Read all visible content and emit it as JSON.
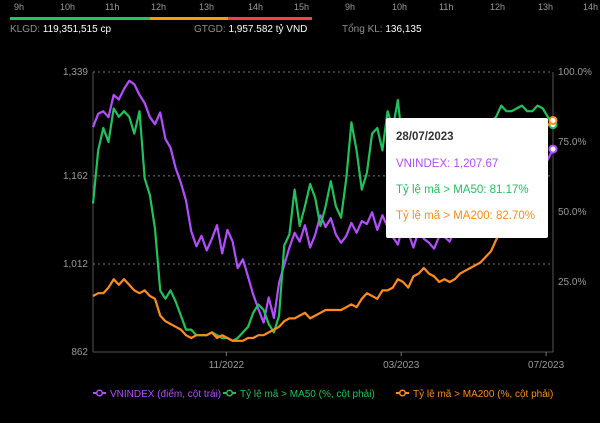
{
  "hours_top": [
    "9h",
    "10h",
    "11h",
    "12h",
    "13h",
    "14h",
    "15h"
  ],
  "hours_right": [
    "9h",
    "10h",
    "11h",
    "12h",
    "13h",
    "14h"
  ],
  "stats": {
    "klgd_label": "KLGD:",
    "klgd_value": "119,351,515 cp",
    "gtgd_label": "GTGD:",
    "gtgd_value": "1,957.582 tỷ VND",
    "tongkl_label": "Tổng KL:",
    "tongkl_value": "136,135"
  },
  "tooltip": {
    "date": "28/07/2023",
    "vnindex": "VNINDEX: 1,207.67",
    "ma50": "Tỷ lệ mã > MA50: 81.17%",
    "ma200": "Tỷ lệ mã > MA200: 82.70%"
  },
  "colors": {
    "vnindex": "#b44cff",
    "ma50": "#20c25c",
    "ma200": "#ff8c1a",
    "green": "#22c55e",
    "orange": "#f59e0b",
    "red": "#ef4444"
  },
  "chart_data": {
    "type": "line",
    "x_ticks": [
      "11/2022",
      "03/2023",
      "07/2023"
    ],
    "y_left": {
      "ticks": [
        862,
        1012,
        1162,
        1339
      ],
      "range": [
        862,
        1339
      ]
    },
    "y_right": {
      "ticks": [
        "25.0%",
        "50.0%",
        "75.0%",
        "100.0%"
      ],
      "range": [
        0,
        100
      ]
    },
    "series": [
      {
        "name": "VNINDEX (điểm, cột trái)",
        "axis": "left",
        "values": [
          1245,
          1268,
          1272,
          1262,
          1300,
          1292,
          1310,
          1324,
          1318,
          1300,
          1286,
          1262,
          1250,
          1270,
          1225,
          1210,
          1175,
          1150,
          1120,
          1068,
          1042,
          1060,
          1035,
          1055,
          1078,
          1030,
          1070,
          1050,
          1005,
          1020,
          990,
          960,
          935,
          912,
          955,
          920,
          980,
          1010,
          1040,
          1065,
          1050,
          1078,
          1040,
          1062,
          1095,
          1075,
          1090,
          1062,
          1048,
          1060,
          1082,
          1065,
          1085,
          1080,
          1100,
          1070,
          1095,
          1075,
          1058,
          1045,
          1080,
          1065,
          1040,
          1068,
          1055,
          1048,
          1038,
          1060,
          1058,
          1050,
          1070,
          1078,
          1075,
          1090,
          1094,
          1080,
          1080,
          1090,
          1095,
          1100,
          1105,
          1110,
          1115,
          1118,
          1125,
          1135,
          1150,
          1175,
          1190,
          1207.67
        ]
      },
      {
        "name": "Tỷ lệ mã > MA50 (%, cột phải)",
        "axis": "right",
        "values": [
          53,
          72,
          80,
          75,
          87,
          84,
          86,
          84,
          78,
          86,
          62,
          56,
          44,
          22,
          19,
          22,
          18,
          13,
          8,
          8,
          6,
          6,
          6,
          7,
          6,
          5,
          5,
          4,
          5,
          7,
          9,
          14,
          17,
          15,
          10,
          7,
          13,
          38,
          42,
          58,
          45,
          52,
          60,
          55,
          45,
          52,
          61,
          52,
          48,
          62,
          82,
          72,
          58,
          64,
          78,
          80,
          72,
          86,
          80,
          90,
          72,
          55,
          70,
          50,
          65,
          52,
          42,
          48,
          63,
          55,
          75,
          70,
          66,
          72,
          74,
          76,
          78,
          82,
          84,
          88,
          86,
          86,
          87,
          88,
          86,
          86,
          88,
          87,
          84,
          81.17
        ]
      },
      {
        "name": "Tỷ lệ mã > MA200 (%, cột phải)",
        "axis": "right",
        "values": [
          20,
          21,
          21,
          23,
          26,
          24,
          26,
          24,
          22,
          21,
          22,
          20,
          19,
          13,
          11,
          10,
          9,
          8,
          6,
          5,
          6,
          6,
          6,
          7,
          5,
          6,
          5,
          4,
          4,
          4,
          5,
          5,
          6,
          6,
          7,
          8,
          9,
          11,
          12,
          12,
          13,
          14,
          12,
          13,
          14,
          15,
          15,
          15,
          15,
          16,
          17,
          16,
          19,
          21,
          20,
          19,
          22,
          22,
          23,
          26,
          25,
          23,
          27,
          28,
          30,
          28,
          27,
          25,
          26,
          25,
          26,
          28,
          29,
          30,
          31,
          32,
          34,
          36,
          40,
          44,
          46,
          52,
          56,
          60,
          65,
          70,
          74,
          78,
          81,
          82.7
        ]
      }
    ],
    "legend": [
      {
        "label": "VNINDEX (điểm, cột trái)",
        "color": "#b44cff"
      },
      {
        "label": "Tỷ lệ mã > MA50 (%, cột phải)",
        "color": "#20c25c"
      },
      {
        "label": "Tỷ lệ mã > MA200 (%, cột phải)",
        "color": "#ff8c1a"
      }
    ]
  }
}
